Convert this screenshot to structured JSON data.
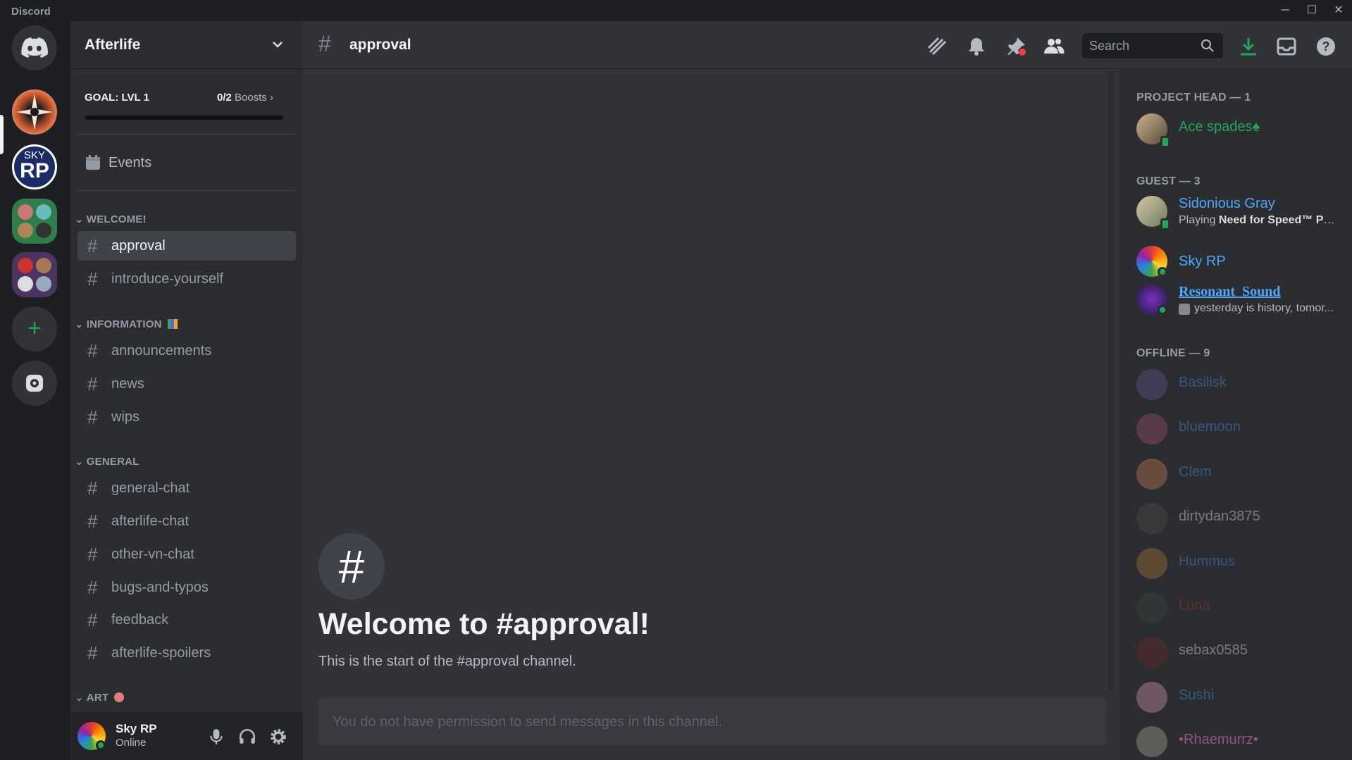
{
  "app": {
    "title": "Discord",
    "minimize": "─",
    "maximize": "☐",
    "close": "✕"
  },
  "server": {
    "name": "Afterlife",
    "goal_label": "GOAL: LVL 1",
    "boosts_count": "0/2",
    "boosts_word": "Boosts",
    "goal_progress": 0,
    "events_label": "Events"
  },
  "guild_list": {
    "sky_rp_text_top": "SKY",
    "sky_rp_text_bottom": "RP",
    "add_label": "+"
  },
  "categories": {
    "welcome": {
      "label": "WELCOME!",
      "channels": [
        "approval",
        "introduce-yourself"
      ]
    },
    "information": {
      "label": "INFORMATION",
      "channels": [
        "announcements",
        "news",
        "wips"
      ]
    },
    "general": {
      "label": "GENERAL",
      "channels": [
        "general-chat",
        "afterlife-chat",
        "other-vn-chat",
        "bugs-and-typos",
        "feedback",
        "afterlife-spoilers"
      ]
    },
    "art": {
      "label": "ART"
    }
  },
  "channel": {
    "hash": "#",
    "name": "approval",
    "search_placeholder": "Search",
    "welcome_title": "Welcome to #approval!",
    "welcome_sub": "This is the start of the #approval channel.",
    "composer_text": "You do not have permission to send messages in this channel."
  },
  "user": {
    "name": "Sky RP",
    "status": "Online"
  },
  "members": {
    "project_head": {
      "label": "PROJECT HEAD — 1",
      "items": [
        {
          "name": "Ace spades♠"
        }
      ]
    },
    "guest": {
      "label": "GUEST — 3",
      "items": [
        {
          "name": "Sidonious Gray",
          "activity_prefix": "Playing ",
          "activity": "Need for Speed™ Pay..."
        },
        {
          "name": "Sky RP"
        },
        {
          "name": "Resonant_Sound",
          "activity": "yesterday is history, tomor..."
        }
      ]
    },
    "offline": {
      "label": "OFFLINE — 9",
      "items": [
        "Basilisk",
        "bluemoon",
        "Clem",
        "dirtydan3875",
        "Hummus",
        "Luna",
        "sebax0585",
        "Sushi",
        "•Rhaemurrz•"
      ]
    }
  },
  "colors": {
    "green": "#23a55a",
    "blurple": "#5865f2",
    "bg": "#313338",
    "sidebar": "#2b2d31",
    "server_bar": "#1e1f22"
  }
}
